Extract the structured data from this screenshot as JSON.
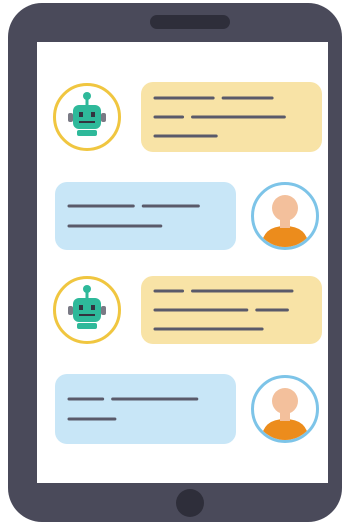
{
  "colors": {
    "device_frame": "#4a4a5a",
    "screen": "#ffffff",
    "bot_bubble": "#f8e3a6",
    "user_bubble": "#c8e6f7",
    "text_line": "#5a5a6a",
    "bot_avatar_ring": "#f0c640",
    "user_avatar_ring": "#7dc4e8",
    "robot": "#2eb99a",
    "person_skin": "#f3c09c",
    "person_shirt": "#ec8c1c"
  },
  "conversation": {
    "messages": [
      {
        "sender": "bot",
        "avatar_icon": "robot-icon",
        "line_groups": [
          [
            0.38,
            0.32
          ],
          [
            0.18,
            0.6
          ],
          [
            0.4
          ]
        ]
      },
      {
        "sender": "user",
        "avatar_icon": "person-icon",
        "line_groups": [
          [
            0.42,
            0.36
          ],
          [
            0.6
          ]
        ]
      },
      {
        "sender": "bot",
        "avatar_icon": "robot-icon",
        "line_groups": [
          [
            0.18,
            0.65
          ],
          [
            0.6,
            0.2
          ],
          [
            0.7
          ]
        ]
      },
      {
        "sender": "user",
        "avatar_icon": "person-icon",
        "line_groups": [
          [
            0.22,
            0.55
          ],
          [
            0.3
          ]
        ]
      }
    ]
  }
}
